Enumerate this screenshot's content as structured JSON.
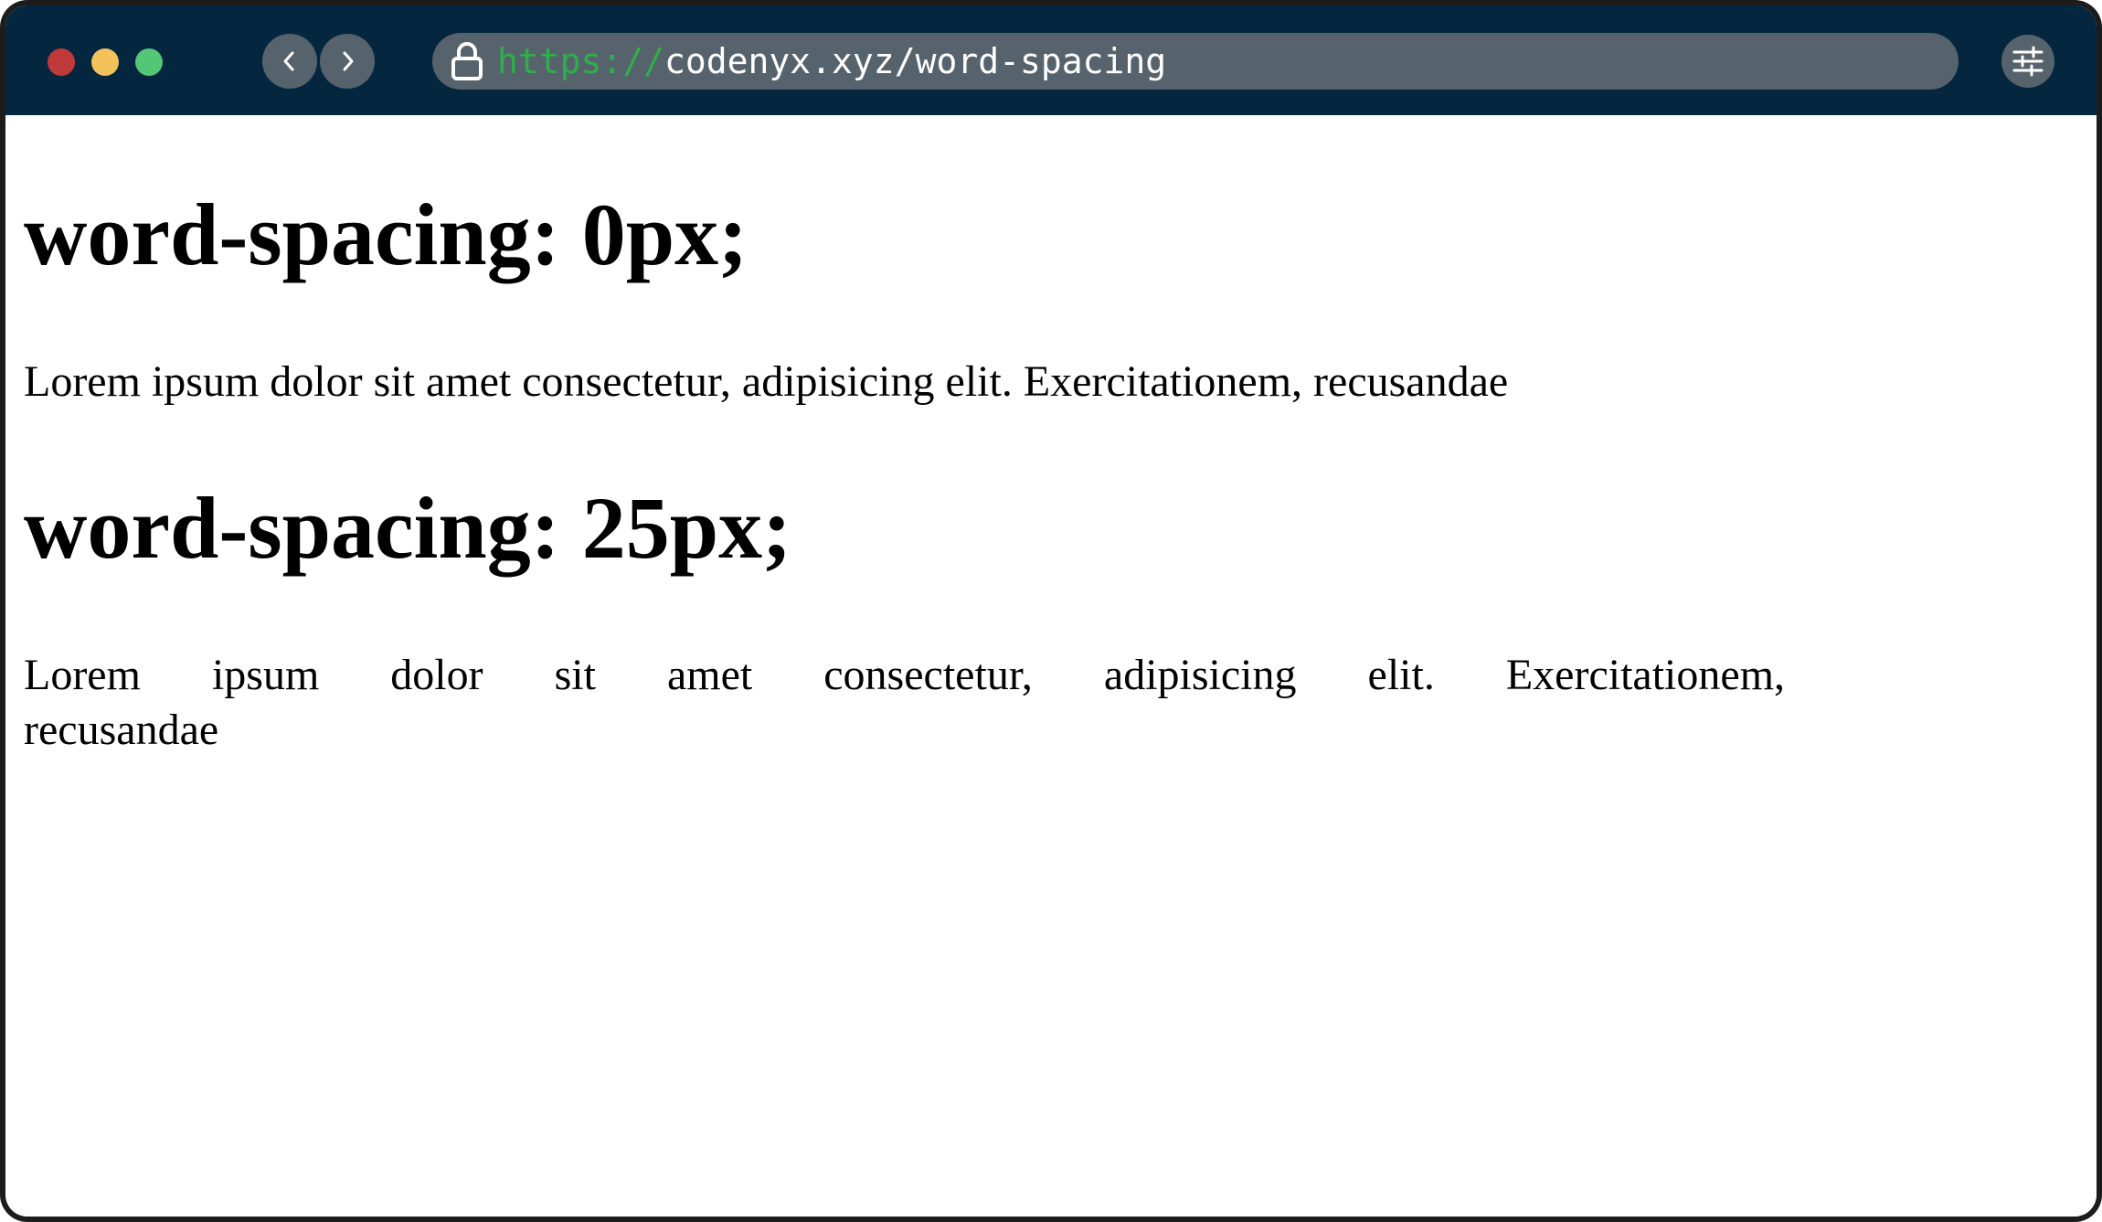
{
  "browser": {
    "url_scheme": "https://",
    "url_rest": "codenyx.xyz/word-spacing",
    "colors": {
      "titlebar": "#04273f",
      "urlbar": "#56636d",
      "scheme": "#2fae4a",
      "close": "#c0393b",
      "minimize": "#f4c25b",
      "maximize": "#54c777"
    }
  },
  "page": {
    "sections": [
      {
        "heading": "word-spacing: 0px;",
        "paragraph": "Lorem ipsum dolor sit amet consectetur, adipisicing elit. Exercitationem, recusandae"
      },
      {
        "heading": "word-spacing: 25px;",
        "paragraph": "Lorem ipsum dolor sit amet consectetur, adipisicing elit. Exercitationem, recusandae"
      }
    ]
  }
}
